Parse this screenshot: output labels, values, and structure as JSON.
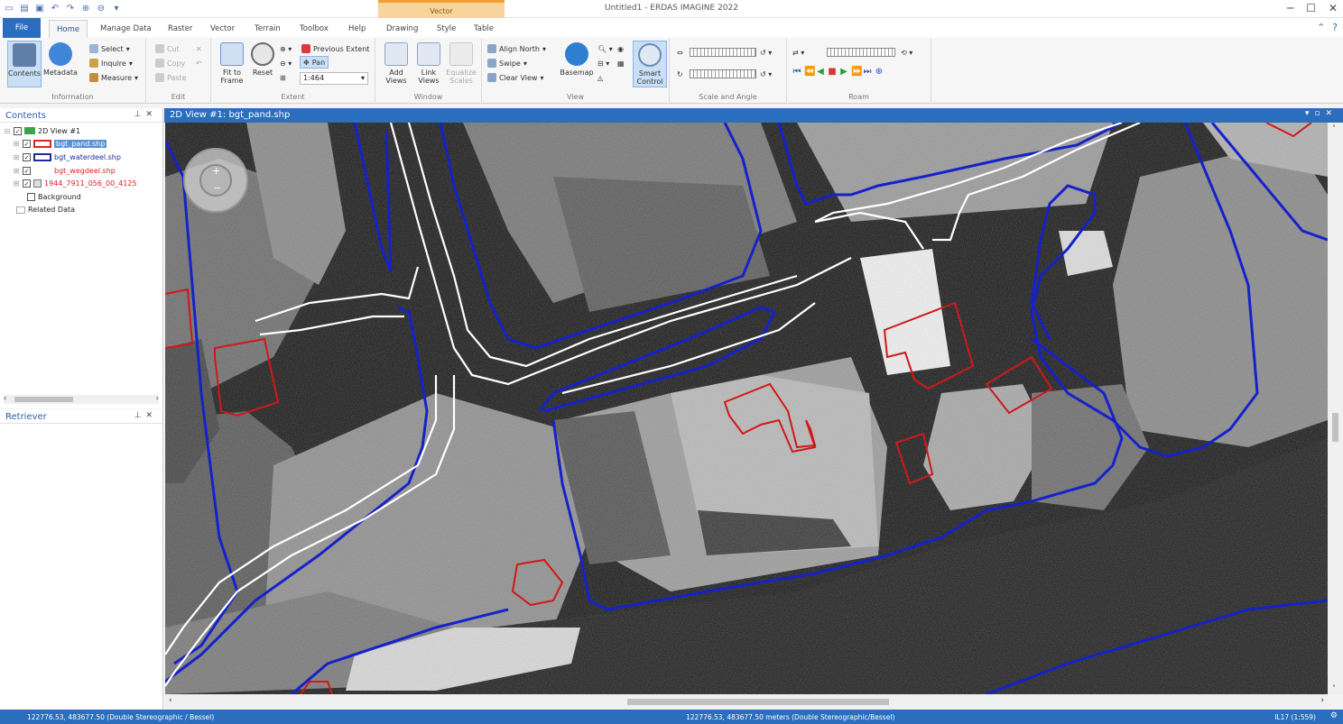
{
  "app": {
    "title": "Untitled1 - ERDAS IMAGINE 2022",
    "contextual_group": "Vector"
  },
  "tabs": [
    "File",
    "Home",
    "Manage Data",
    "Raster",
    "Vector",
    "Terrain",
    "Toolbox",
    "Help",
    "Drawing",
    "Style",
    "Table"
  ],
  "ribbon": {
    "information": {
      "label": "Information",
      "contents": "Contents",
      "metadata": "Metadata",
      "select": "Select",
      "inquire": "Inquire",
      "measure": "Measure"
    },
    "edit": {
      "label": "Edit",
      "cut": "Cut",
      "copy": "Copy",
      "paste": "Paste"
    },
    "extent": {
      "label": "Extent",
      "fit_to_frame": "Fit to Frame",
      "reset": "Reset",
      "previous_extent": "Previous Extent",
      "pan": "Pan",
      "scale": "1:464"
    },
    "window": {
      "label": "Window",
      "add_views": "Add Views",
      "link_views": "Link Views",
      "equalize_scales": "Equalize Scales"
    },
    "view": {
      "label": "View",
      "align_north": "Align North",
      "swipe": "Swipe",
      "clear_view": "Clear View",
      "basemap": "Basemap",
      "smart_control": "Smart Control"
    },
    "scale_angle": {
      "label": "Scale and Angle"
    },
    "roam": {
      "label": "Roam"
    }
  },
  "contents_panel": {
    "title": "Contents",
    "items": [
      {
        "label": "2D View #1"
      },
      {
        "label": "bgt_pand.shp"
      },
      {
        "label": "bgt_waterdeel.shp"
      },
      {
        "label": "bgt_wegdeel.shp"
      },
      {
        "label": "1944_7911_056_00_4125"
      },
      {
        "label": "Background"
      },
      {
        "label": "Related Data"
      }
    ]
  },
  "retriever_panel": {
    "title": "Retriever"
  },
  "view": {
    "title": "2D View #1: bgt_pand.shp"
  },
  "status": {
    "left": "122776.53, 483677.50  (Double Stereographic / Bessel)",
    "center": "122776.53, 483677.50 meters (Double Stereographic/Bessel)",
    "right": "IL17 (1:559)"
  }
}
